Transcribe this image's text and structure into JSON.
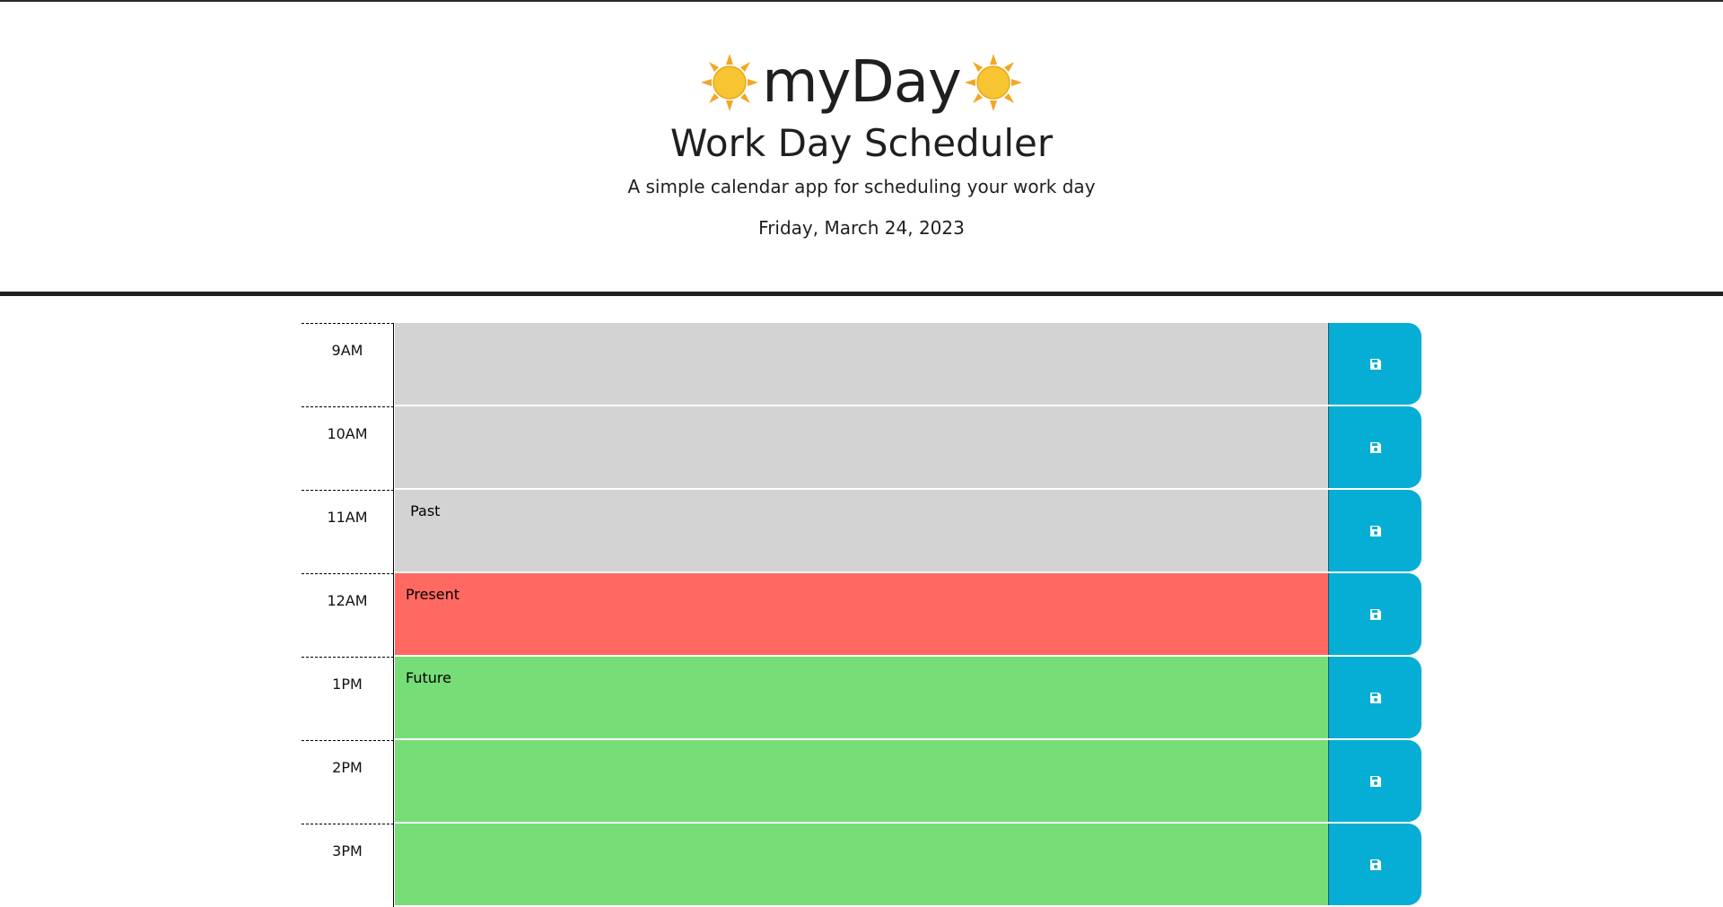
{
  "header": {
    "brand": "myDay",
    "title": "Work Day Scheduler",
    "subtitle": "A simple calendar app for scheduling your work day",
    "date": "Friday, March 24, 2023",
    "icons": [
      "sun-icon",
      "sun-icon"
    ]
  },
  "colors": {
    "past": "#d3d3d3",
    "present": "#ff6961",
    "future": "#77dd77",
    "save_button": "#06aed5"
  },
  "hours": [
    {
      "label": "9AM",
      "state": "past",
      "text": ""
    },
    {
      "label": "10AM",
      "state": "past",
      "text": ""
    },
    {
      "label": "11AM",
      "state": "past",
      "text": " Past"
    },
    {
      "label": "12AM",
      "state": "present",
      "text": "Present"
    },
    {
      "label": "1PM",
      "state": "future",
      "text": "Future"
    },
    {
      "label": "2PM",
      "state": "future",
      "text": ""
    },
    {
      "label": "3PM",
      "state": "future",
      "text": ""
    }
  ],
  "save_icon": "floppy-disk-icon"
}
